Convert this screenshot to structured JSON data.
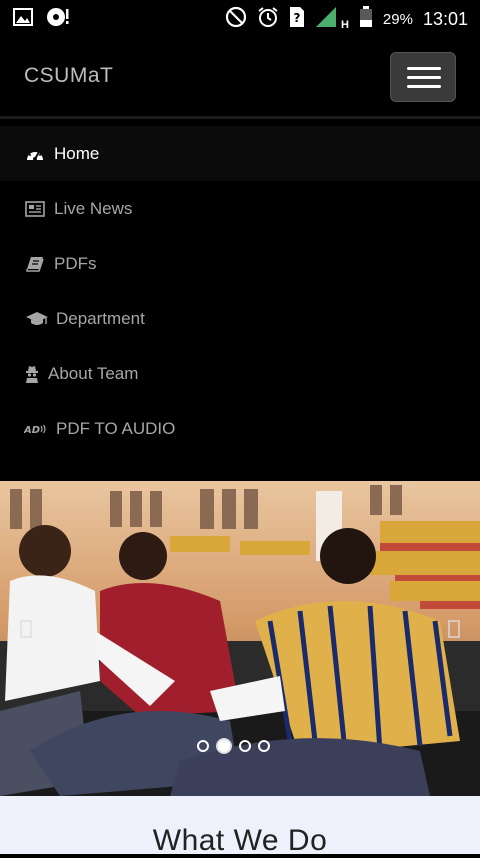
{
  "status_bar": {
    "battery_percent": "29%",
    "time": "13:01",
    "network_type": "H",
    "icons": [
      "image-notification-icon",
      "media-notification-icon",
      "do-not-disturb-icon",
      "alarm-icon",
      "unknown-sim-icon",
      "signal-icon",
      "battery-icon"
    ]
  },
  "navbar": {
    "brand": "CSUMaT",
    "toggler_icon": "hamburger-menu-icon"
  },
  "menu": {
    "items": [
      {
        "label": "Home",
        "icon": "dashboard-icon",
        "active": true
      },
      {
        "label": "Live News",
        "icon": "newspaper-icon",
        "active": false
      },
      {
        "label": "PDFs",
        "icon": "book-icon",
        "active": false
      },
      {
        "label": "Department",
        "icon": "graduation-cap-icon",
        "active": false
      },
      {
        "label": "About Team",
        "icon": "user-secret-icon",
        "active": false
      },
      {
        "label": "PDF TO AUDIO",
        "icon": "audio-description-icon",
        "active": false
      }
    ]
  },
  "carousel": {
    "prev_icon": "chevron-left-icon",
    "next_icon": "chevron-right-icon",
    "slides": 4,
    "active_slide": 2
  },
  "section": {
    "title": "What We Do"
  },
  "colors": {
    "background": "#000000",
    "menu_text": "#a6a6a6",
    "active_text": "#ffffff",
    "section_bg": "#eef0fb"
  }
}
